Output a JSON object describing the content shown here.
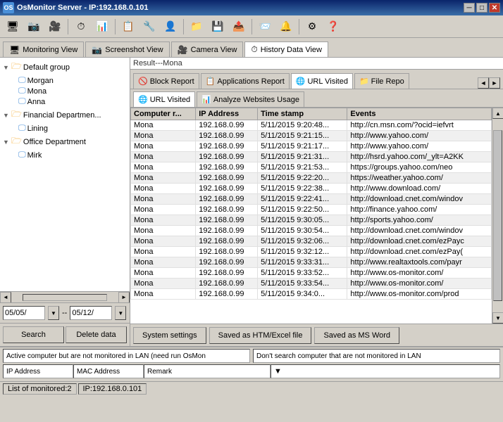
{
  "titlebar": {
    "title": "OsMonitor Server - IP:192.168.0.101",
    "icon": "OS",
    "min_label": "─",
    "max_label": "□",
    "close_label": "✕"
  },
  "toolbar": {
    "icons": [
      "🖥",
      "📷",
      "🎥",
      "⏱",
      "📊",
      "📋",
      "🔧",
      "👤",
      "📁",
      "💾",
      "📤",
      "📨",
      "🔔",
      "⚙",
      "❓"
    ]
  },
  "main_tabs": [
    {
      "id": "monitoring",
      "label": "Monitoring View",
      "icon": "🖥"
    },
    {
      "id": "screenshot",
      "label": "Screenshot View",
      "icon": "📷"
    },
    {
      "id": "camera",
      "label": "Camera View",
      "icon": "🎥"
    },
    {
      "id": "history",
      "label": "History Data View",
      "icon": "⏱",
      "active": true
    }
  ],
  "result_label": "Result---Mona",
  "sub_tabs": [
    {
      "id": "block",
      "label": "Block Report",
      "icon": "🚫",
      "active": false
    },
    {
      "id": "applications",
      "label": "Applications Report",
      "icon": "📋",
      "active": false
    },
    {
      "id": "url",
      "label": "URL Visited",
      "icon": "🌐",
      "active": true
    },
    {
      "id": "file",
      "label": "File Repo",
      "icon": "📁",
      "active": false
    }
  ],
  "sub_tabs2": [
    {
      "id": "url_visited",
      "label": "URL Visited",
      "icon": "🌐",
      "active": true
    },
    {
      "id": "analyze",
      "label": "Analyze Websites Usage",
      "icon": "📊",
      "active": false
    }
  ],
  "table": {
    "columns": [
      "Computer r...",
      "IP Address",
      "Time stamp",
      "Events"
    ],
    "rows": [
      {
        "computer": "Mona",
        "ip": "192.168.0.99",
        "time": "5/11/2015 9:20:48...",
        "event": "http://cn.msn.com/?ocid=iefvrt"
      },
      {
        "computer": "Mona",
        "ip": "192.168.0.99",
        "time": "5/11/2015 9:21:15...",
        "event": "http://www.yahoo.com/"
      },
      {
        "computer": "Mona",
        "ip": "192.168.0.99",
        "time": "5/11/2015 9:21:17...",
        "event": "http://www.yahoo.com/"
      },
      {
        "computer": "Mona",
        "ip": "192.168.0.99",
        "time": "5/11/2015 9:21:31...",
        "event": "http://hsrd.yahoo.com/_ylt=A2KK"
      },
      {
        "computer": "Mona",
        "ip": "192.168.0.99",
        "time": "5/11/2015 9:21:53...",
        "event": "https://groups.yahoo.com/neo"
      },
      {
        "computer": "Mona",
        "ip": "192.168.0.99",
        "time": "5/11/2015 9:22:20...",
        "event": "https://weather.yahoo.com/"
      },
      {
        "computer": "Mona",
        "ip": "192.168.0.99",
        "time": "5/11/2015 9:22:38...",
        "event": "http://www.download.com/"
      },
      {
        "computer": "Mona",
        "ip": "192.168.0.99",
        "time": "5/11/2015 9:22:41...",
        "event": "http://download.cnet.com/windov"
      },
      {
        "computer": "Mona",
        "ip": "192.168.0.99",
        "time": "5/11/2015 9:22:50...",
        "event": "http://finance.yahoo.com/"
      },
      {
        "computer": "Mona",
        "ip": "192.168.0.99",
        "time": "5/11/2015 9:30:05...",
        "event": "http://sports.yahoo.com/"
      },
      {
        "computer": "Mona",
        "ip": "192.168.0.99",
        "time": "5/11/2015 9:30:54...",
        "event": "http://download.cnet.com/windov"
      },
      {
        "computer": "Mona",
        "ip": "192.168.0.99",
        "time": "5/11/2015 9:32:06...",
        "event": "http://download.cnet.com/ezPayc"
      },
      {
        "computer": "Mona",
        "ip": "192.168.0.99",
        "time": "5/11/2015 9:32:12...",
        "event": "http://download.cnet.com/ezPay("
      },
      {
        "computer": "Mona",
        "ip": "192.168.0.99",
        "time": "5/11/2015 9:33:31...",
        "event": "http://www.realtaxtools.com/payr"
      },
      {
        "computer": "Mona",
        "ip": "192.168.0.99",
        "time": "5/11/2015 9:33:52...",
        "event": "http://www.os-monitor.com/"
      },
      {
        "computer": "Mona",
        "ip": "192.168.0.99",
        "time": "5/11/2015 9:33:54...",
        "event": "http://www.os-monitor.com/"
      },
      {
        "computer": "Mona",
        "ip": "192.168.0.99",
        "time": "5/11/2015 9:34:0...",
        "event": "http://www.os-monitor.com/prod"
      }
    ]
  },
  "sidebar": {
    "groups": [
      {
        "name": "Default group",
        "expanded": true,
        "computers": [
          "Morgan",
          "Mona",
          "Anna"
        ]
      },
      {
        "name": "Financial Departmen...",
        "expanded": true,
        "computers": [
          "Lining"
        ]
      },
      {
        "name": "Office Department",
        "expanded": true,
        "computers": [
          "Mirk"
        ]
      }
    ]
  },
  "date_range": {
    "from": "05/05/",
    "to": "05/12/",
    "separator": "--"
  },
  "buttons": {
    "search": "Search",
    "delete": "Delete data"
  },
  "bottom_buttons": {
    "system_settings": "System settings",
    "save_htm": "Saved as HTM/Excel file",
    "save_word": "Saved as MS Word"
  },
  "statusbar": {
    "row1_left": "Active computer but are not monitored in LAN (need run OsMon",
    "row1_right": "Don't search computer that are not monitored in LAN",
    "columns": [
      "IP Address",
      "MAC Address",
      "Remark",
      ""
    ],
    "dropdown_icon": "▼"
  },
  "infobar": {
    "left": "List of monitored:2",
    "right": "IP:192.168.0.101"
  }
}
